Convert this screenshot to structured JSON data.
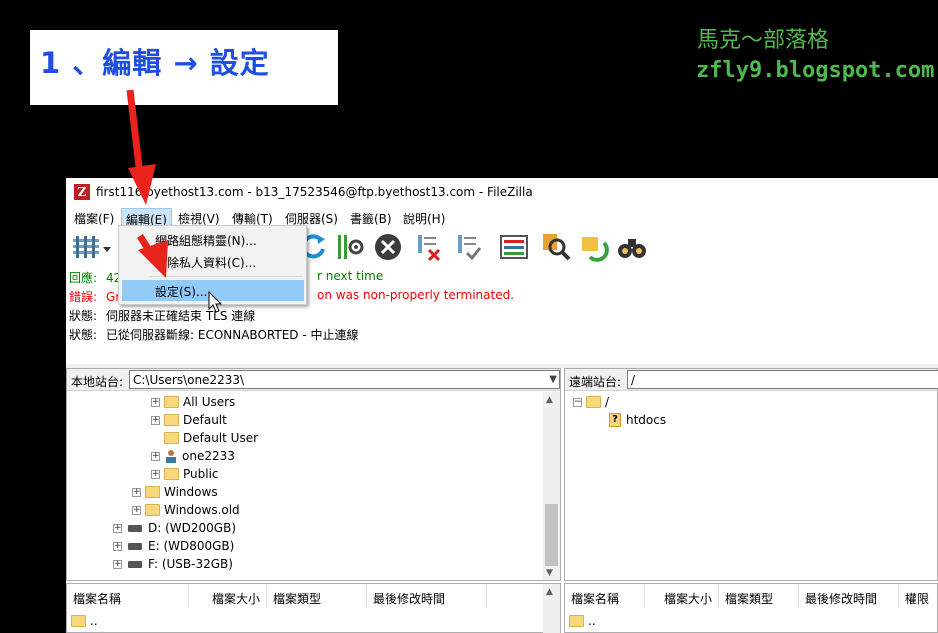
{
  "annotation": {
    "step": "1 、編輯 → 設定",
    "blog_title": "馬克～部落格",
    "blog_url": "zfly9.blogspot.com"
  },
  "window": {
    "title": "first116.byethost13.com - b13_17523546@ftp.byethost13.com - FileZilla",
    "app_icon": "Z"
  },
  "menubar": [
    "檔案(F)",
    "編輯(E)",
    "檢視(V)",
    "傳輸(T)",
    "伺服器(S)",
    "書籤(B)",
    "說明(H)"
  ],
  "edit_menu": {
    "items": [
      "網路組態精靈(N)...",
      "清除私人資料(C)...",
      "設定(S)..."
    ]
  },
  "log": [
    {
      "label": "回應:",
      "text": "42",
      "tail": "r next time",
      "color": "#008000"
    },
    {
      "label": "錯誤:",
      "text": "Gr",
      "tail": "on was non-properly terminated.",
      "color": "#ff0000"
    },
    {
      "label": "狀態:",
      "text": "伺服器未正確結束 TLS 連線",
      "tail": "",
      "color": "#000000"
    },
    {
      "label": "狀態:",
      "text": "已從伺服器斷線: ECONNABORTED - 中止連線",
      "tail": "",
      "color": "#000000"
    }
  ],
  "local": {
    "label": "本地站台:",
    "path": "C:\\Users\\one2233\\",
    "tree": [
      "All Users",
      "Default",
      "Default User",
      "one2233",
      "Public",
      "Windows",
      "Windows.old",
      "D: (WD200GB)",
      "E: (WD800GB)",
      "F: (USB-32GB)"
    ],
    "columns": [
      "檔案名稱",
      "檔案大小",
      "檔案類型",
      "最後修改時間"
    ],
    "files": [
      ".."
    ]
  },
  "remote": {
    "label": "遠端站台:",
    "path": "/",
    "tree": [
      "/",
      "htdocs"
    ],
    "columns": [
      "檔案名稱",
      "檔案大小",
      "檔案類型",
      "最後修改時間",
      "權限"
    ],
    "files": [
      ".."
    ]
  },
  "colors": {
    "accent_blue": "#1f4fe0",
    "blog_green": "#4fb84f",
    "arrow_red": "#e8231c",
    "menu_highlight": "#91c9f7"
  }
}
